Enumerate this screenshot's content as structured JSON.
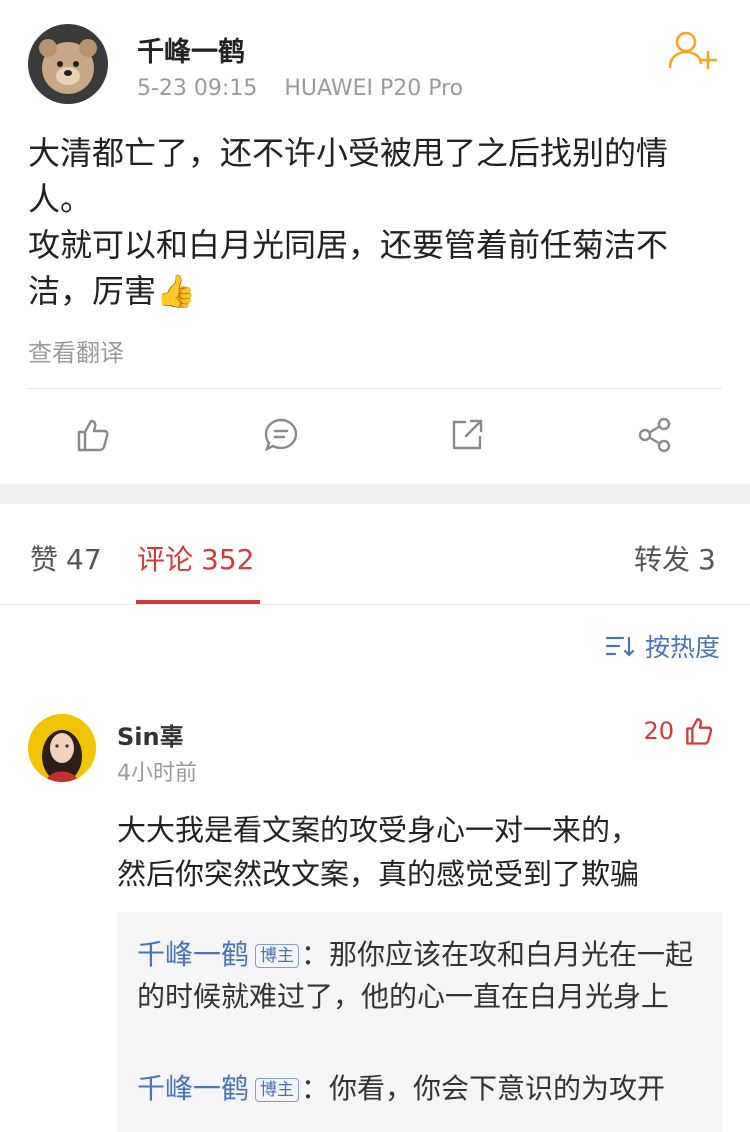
{
  "post": {
    "author": "千峰一鹤",
    "date": "5-23 09:15",
    "device": "HUAWEI P20 Pro",
    "content_lines": [
      "大清都亡了，还不许小受被甩了之后找别的情人。",
      "攻就可以和白月光同居，还要管着前任菊洁不洁，厉害👍"
    ],
    "translate_label": "查看翻译"
  },
  "tabs": {
    "likes": {
      "label": "赞",
      "count": "47"
    },
    "comments": {
      "label": "评论",
      "count": "352"
    },
    "reposts": {
      "label": "转发",
      "count": "3"
    }
  },
  "sort_label": "按热度",
  "comment": {
    "user": "Sin辜",
    "time": "4小时前",
    "likes": "20",
    "text_lines": [
      "大大我是看文案的攻受身心一对一来的，",
      "然后你突然改文案，真的感觉受到了欺骗"
    ],
    "replies": [
      {
        "name": "千峰一鹤",
        "badge": "博主",
        "text": "：那你应该在攻和白月光在一起的时候就难过了，他的心一直在白月光身上"
      },
      {
        "name": "千峰一鹤",
        "badge": "博主",
        "text": "：你看，你会下意识的为攻开"
      }
    ]
  },
  "colors": {
    "accent": "#d33a3a",
    "link": "#4a74b4",
    "follow": "#f5a623"
  }
}
